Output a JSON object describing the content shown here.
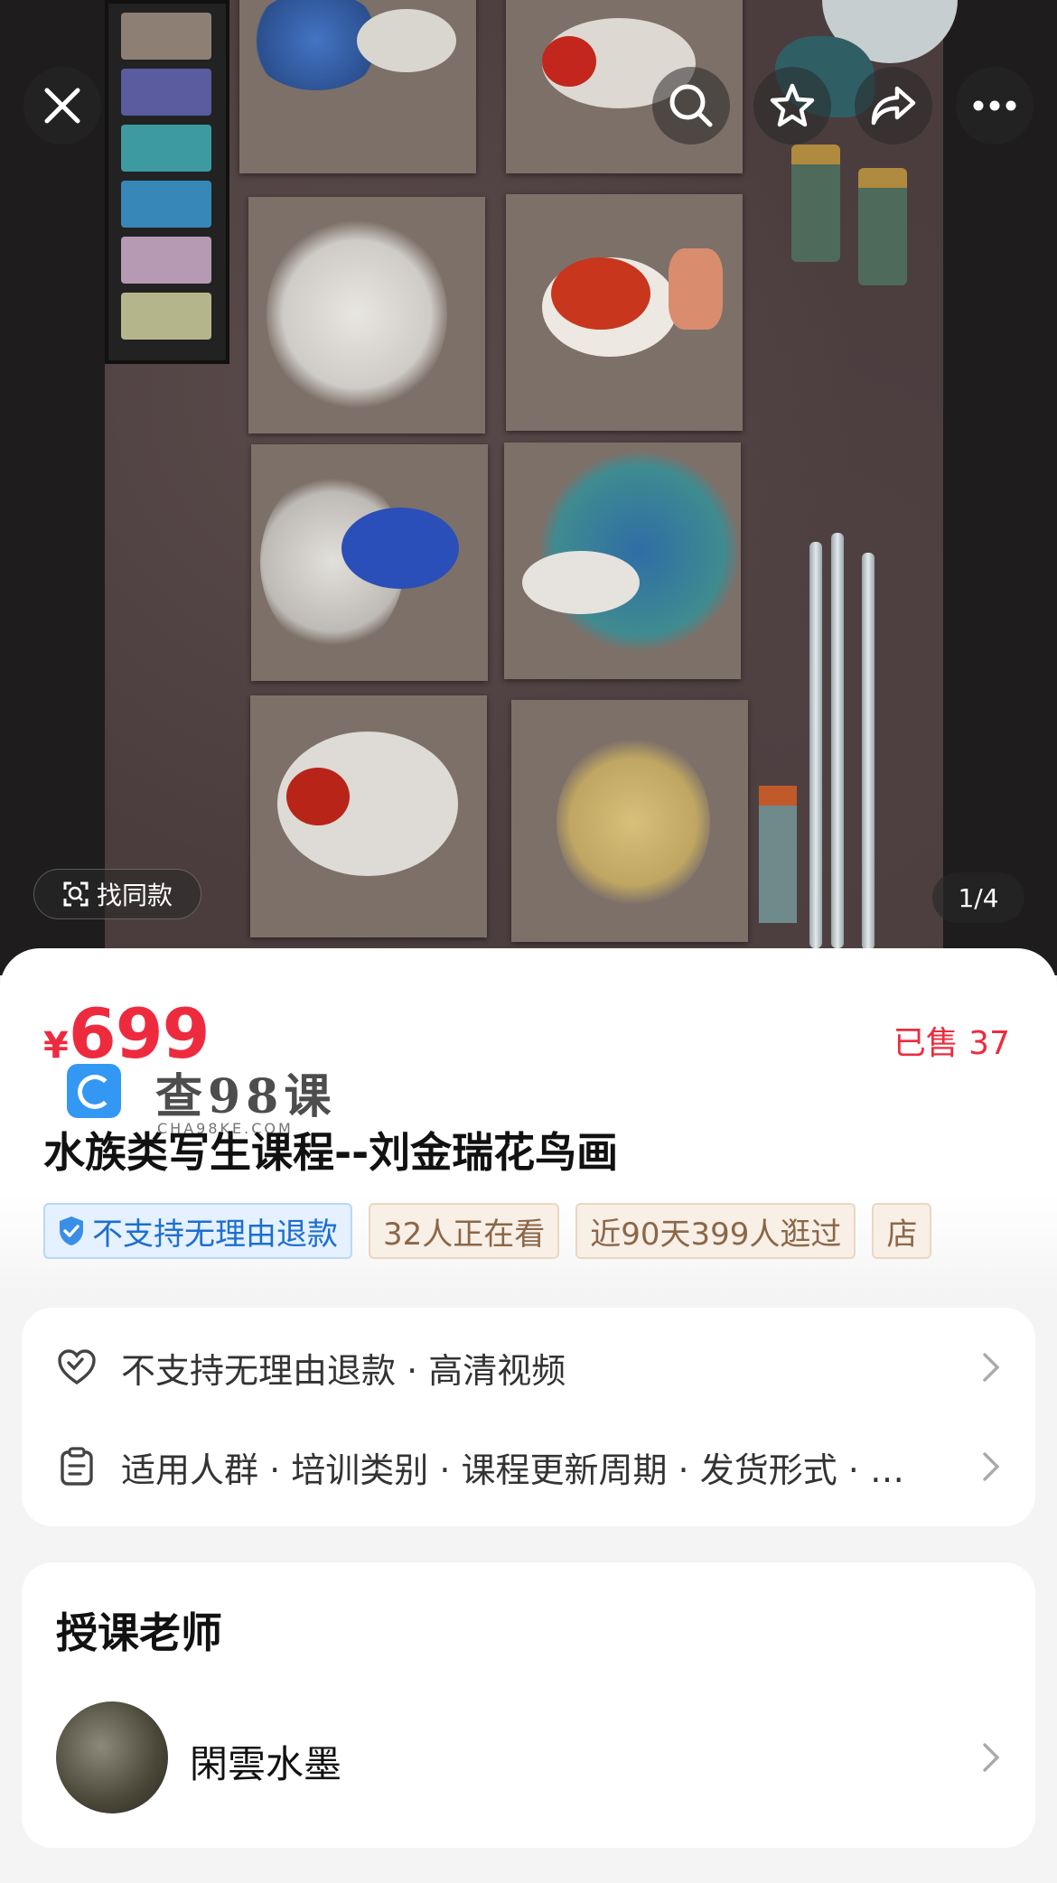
{
  "top_bar": {
    "close_icon": "close-icon",
    "actions": [
      "search-icon",
      "star-icon",
      "share-icon",
      "more-icon"
    ]
  },
  "image": {
    "find_same_label": "找同款",
    "counter": "1/4"
  },
  "product": {
    "currency": "¥",
    "price": "699",
    "sold": "已售 37",
    "title": "水族类写生课程--刘金瑞花鸟画",
    "tags": [
      "不支持无理由退款",
      "32人正在看",
      "近90天399人逛过",
      "店"
    ]
  },
  "watermark": {
    "text": "查98课",
    "sub": "CHA98KE.COM"
  },
  "service": {
    "row1": "不支持无理由退款 · 高清视频",
    "row2": "适用人群 · 培训类别 · 课程更新周期 · 发货形式 · …"
  },
  "teacher": {
    "section_title": "授课老师",
    "name": "閑雲水墨"
  },
  "colors": {
    "price_red": "#ee2b3e",
    "tag_blue": "#1d6fce",
    "tag_beige": "#8a6748"
  }
}
